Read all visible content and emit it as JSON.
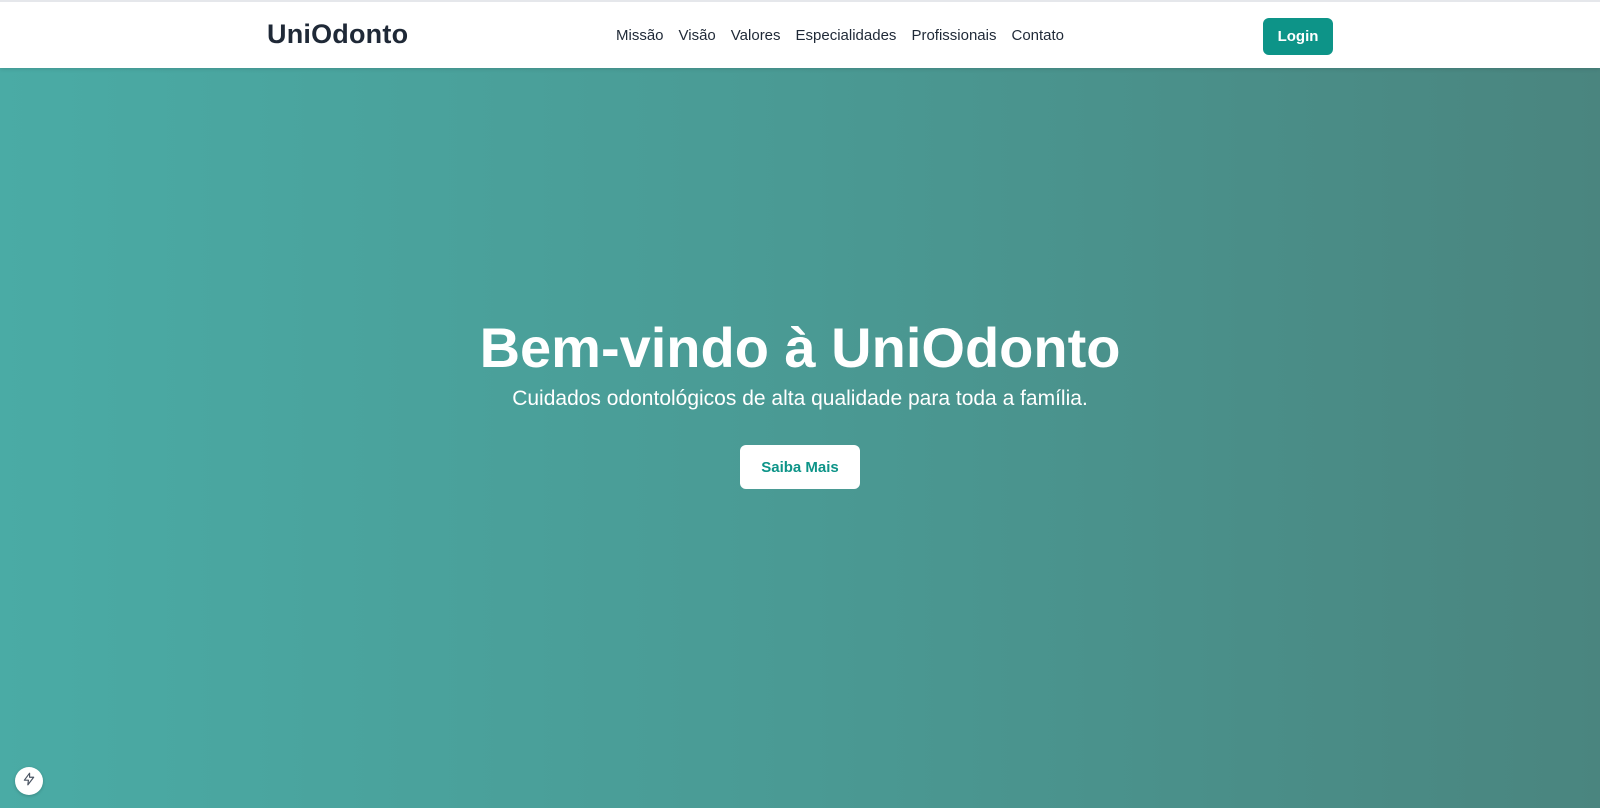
{
  "header": {
    "logo": "UniOdonto",
    "nav_items": [
      {
        "label": "Missão"
      },
      {
        "label": "Visão"
      },
      {
        "label": "Valores"
      },
      {
        "label": "Especialidades"
      },
      {
        "label": "Profissionais"
      },
      {
        "label": "Contato"
      }
    ],
    "login_label": "Login"
  },
  "hero": {
    "title": "Bem-vindo à UniOdonto",
    "subtitle": "Cuidados odontológicos de alta qualidade para toda a família.",
    "cta_label": "Saiba Mais"
  },
  "floating_badge": {
    "icon": "lightning-bolt-icon"
  },
  "colors": {
    "accent": "#0d9488",
    "hero_gradient_start": "#4aaba5",
    "hero_gradient_end": "#4a857f",
    "text_dark": "#1f2937"
  }
}
